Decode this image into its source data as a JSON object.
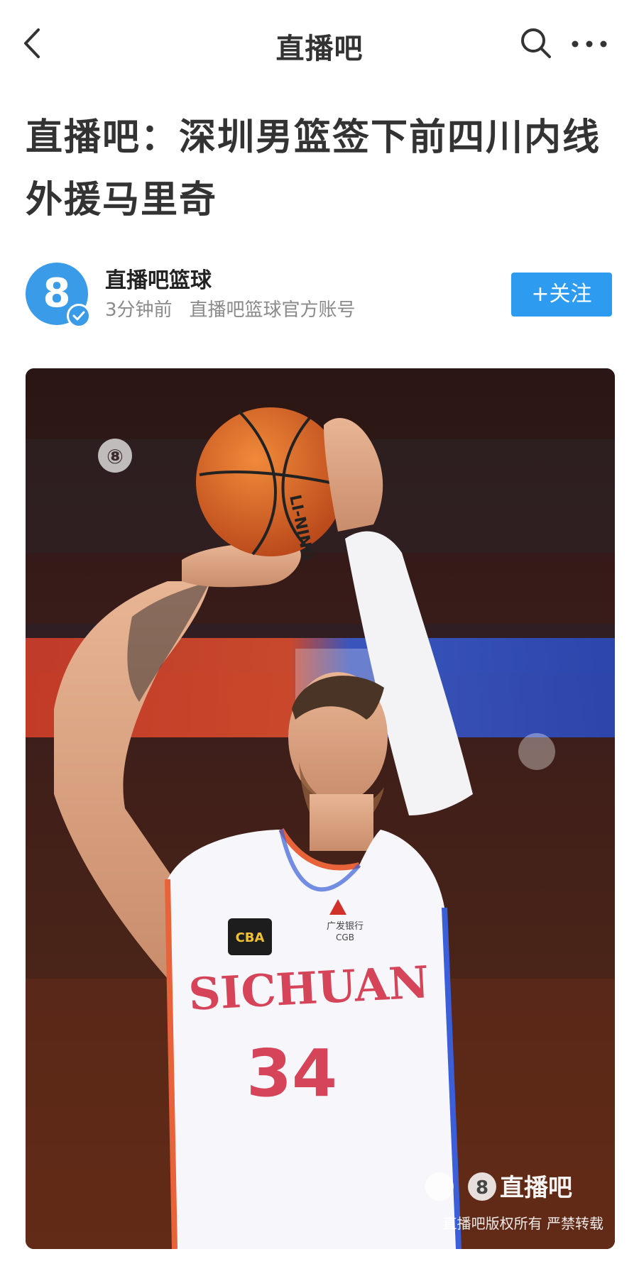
{
  "topbar": {
    "title": "直播吧",
    "back_icon": "chevron-left-icon",
    "search_icon": "search-icon",
    "more_icon": "more-icon"
  },
  "article": {
    "headline": "直播吧：深圳男篮签下前四川内线外援马里奇"
  },
  "author": {
    "name": "直播吧篮球",
    "time": "3分钟前",
    "description": "直播吧篮球官方账号",
    "avatar_glyph": "8",
    "follow_label": "+关注"
  },
  "photo": {
    "corner_logo": "⑧",
    "ball_brand": "LI-NING",
    "jersey_team": "SICHUAN",
    "jersey_number": "34",
    "jersey_sponsor": "广发银行",
    "jersey_sponsor_sub": "CGB",
    "watermark_logo": "直播吧",
    "watermark_text": "直播吧版权所有 严禁转载"
  },
  "colors": {
    "accent": "#2d9bf0",
    "title_text": "#333333",
    "meta_text": "#8a8a8a"
  }
}
